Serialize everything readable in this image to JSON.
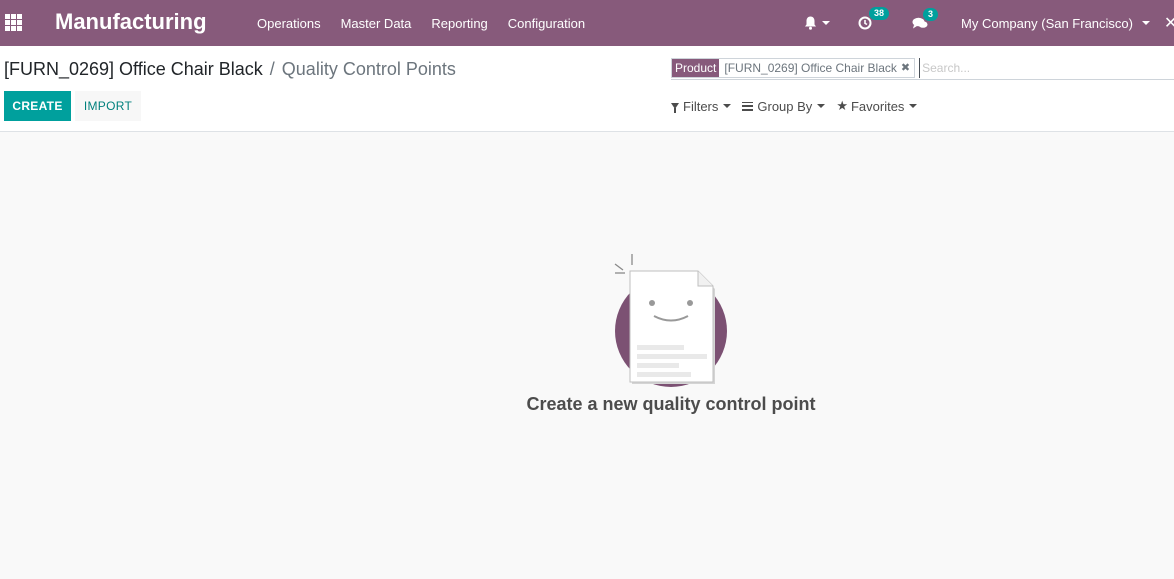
{
  "navbar": {
    "app_name": "Manufacturing",
    "menu": [
      "Operations",
      "Master Data",
      "Reporting",
      "Configuration"
    ],
    "activity_count": "38",
    "message_count": "3",
    "company": "My Company (San Francisco)",
    "accent_color": "#875a7b"
  },
  "breadcrumb": {
    "parent": "[FURN_0269] Office Chair Black",
    "separator": "/",
    "current": "Quality Control Points"
  },
  "buttons": {
    "create": "CREATE",
    "import": "IMPORT"
  },
  "search": {
    "facet_label": "Product",
    "facet_value": "[FURN_0269] Office Chair Black",
    "placeholder": "Search..."
  },
  "search_options": {
    "filters": "Filters",
    "group_by": "Group By",
    "favorites": "Favorites"
  },
  "empty_state": {
    "title": "Create a new quality control point"
  },
  "icons": {
    "apps": "apps-grid-icon",
    "bell": "bell-icon",
    "activity": "clock-icon",
    "messages": "comments-icon",
    "filter": "funnel-icon",
    "group": "bars-icon",
    "favorite": "star-icon"
  }
}
